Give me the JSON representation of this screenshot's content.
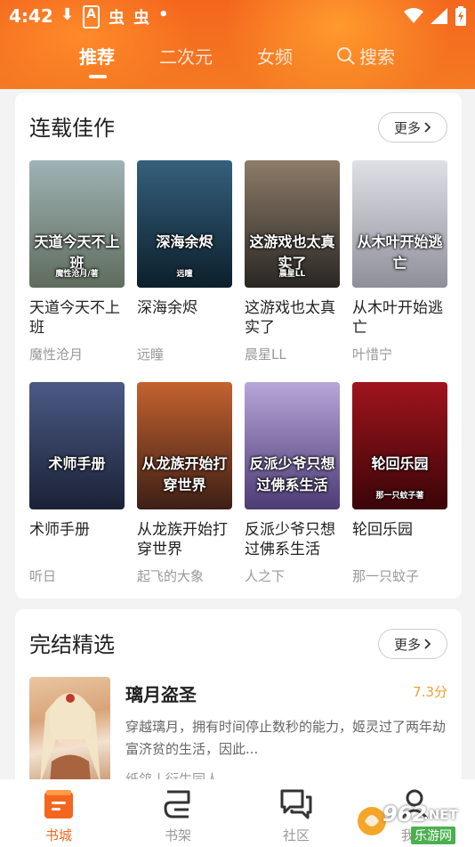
{
  "status_bar": {
    "time": "4:42",
    "notification_glyphs": [
      "⬇",
      "A",
      "虫",
      "虫",
      "•"
    ]
  },
  "tabs": [
    {
      "label": "推荐",
      "active": true
    },
    {
      "label": "二次元",
      "active": false
    },
    {
      "label": "女频",
      "active": false
    },
    {
      "label": "搜索",
      "active": false,
      "icon": "search-icon"
    }
  ],
  "serial_section": {
    "title": "连载佳作",
    "more_label": "更多",
    "books": [
      {
        "title": "天道今天不上班",
        "author": "魔性沧月",
        "cover_text": "天道今天不上班",
        "cover_sub": "魔性沧月/著",
        "colors": [
          "#9fb3b5",
          "#5f6c5d"
        ]
      },
      {
        "title": "深海余烬",
        "author": "远瞳",
        "cover_text": "深海余烬",
        "cover_sub": "远瞳",
        "colors": [
          "#35607d",
          "#0c1f2b"
        ]
      },
      {
        "title": "这游戏也太真实了",
        "author": "晨星LL",
        "cover_text": "这游戏也太真实了",
        "cover_sub": "晨星LL",
        "colors": [
          "#8d7c68",
          "#2a2724"
        ]
      },
      {
        "title": "从木叶开始逃亡",
        "author": "叶惜宁",
        "cover_text": "从木叶开始逃亡",
        "cover_sub": "",
        "colors": [
          "#dfe0e6",
          "#8f8f9a"
        ]
      },
      {
        "title": "术师手册",
        "author": "听日",
        "cover_text": "术师手册",
        "cover_sub": "",
        "colors": [
          "#4b5a86",
          "#1b2236"
        ]
      },
      {
        "title": "从龙族开始打穿世界",
        "author": "起飞的大象",
        "cover_text": "从龙族开始打穿世界",
        "cover_sub": "",
        "colors": [
          "#c4622f",
          "#3d1f16"
        ]
      },
      {
        "title": "反派少爷只想过佛系生活",
        "author": "人之下",
        "cover_text": "反派少爷只想过佛系生活",
        "cover_sub": "",
        "colors": [
          "#b7a6d8",
          "#4c3b75"
        ]
      },
      {
        "title": "轮回乐园",
        "author": "那一只蚊子",
        "cover_text": "轮回乐园",
        "cover_sub": "那一只蚊子著",
        "colors": [
          "#a0141d",
          "#3a0508"
        ]
      }
    ]
  },
  "finished_section": {
    "title": "完结精选",
    "more_label": "更多",
    "featured": {
      "title": "璃月盗圣",
      "score": "7.3分",
      "description": "穿越璃月，拥有时间停止数秒的能力，姬灵过了两年劫富济贫的生活，因此...",
      "author": "纸鸽丨衍生同人"
    }
  },
  "bottom_nav": [
    {
      "label": "书城",
      "icon": "bookstore-icon",
      "active": true
    },
    {
      "label": "书架",
      "icon": "bookshelf-icon",
      "active": false
    },
    {
      "label": "社区",
      "icon": "community-icon",
      "active": false
    },
    {
      "label": "我的",
      "icon": "profile-icon",
      "active": false
    }
  ],
  "watermark": {
    "brand": "962",
    "brand_suffix": ".NET",
    "sub": "乐游网"
  },
  "colors": {
    "accent": "#f4661e",
    "score": "#f0a030",
    "muted": "#999999"
  }
}
